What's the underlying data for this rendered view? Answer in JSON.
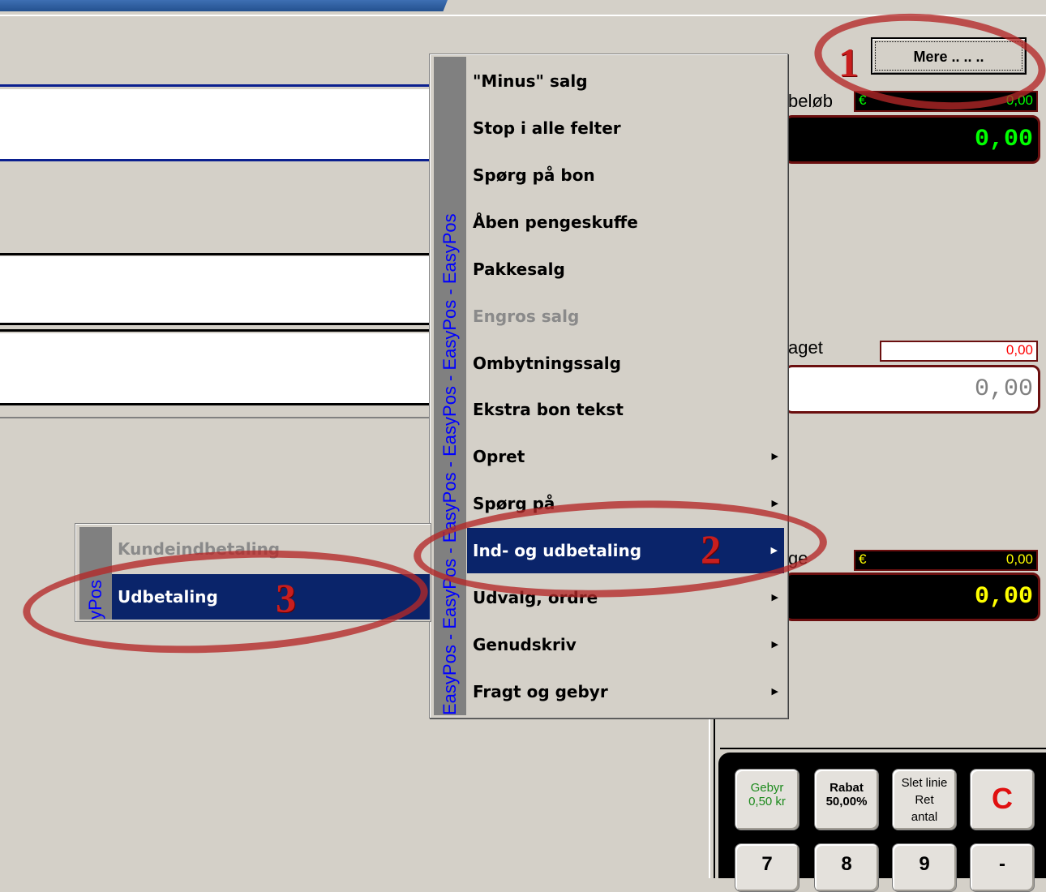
{
  "menu": {
    "strip_text": "EasyPos  -  EasyPos  -  EasyPos  -  EasyPos  -  EasyPos  -  EasyPos",
    "items": [
      {
        "label": "\"Minus\" salg",
        "enabled": true,
        "submenu": false
      },
      {
        "label": "Stop i alle felter",
        "enabled": true,
        "submenu": false
      },
      {
        "label": "Spørg på bon",
        "enabled": true,
        "submenu": false
      },
      {
        "label": "Åben pengeskuffe",
        "enabled": true,
        "submenu": false
      },
      {
        "label": "Pakkesalg",
        "enabled": true,
        "submenu": false
      },
      {
        "label": "Engros salg",
        "enabled": false,
        "submenu": false
      },
      {
        "label": "Ombytningssalg",
        "enabled": true,
        "submenu": false
      },
      {
        "label": "Ekstra bon tekst",
        "enabled": true,
        "submenu": false
      },
      {
        "label": "Opret",
        "enabled": true,
        "submenu": true
      },
      {
        "label": "Spørg på",
        "enabled": true,
        "submenu": true
      },
      {
        "label": "Ind- og udbetaling",
        "enabled": true,
        "submenu": true,
        "selected": true
      },
      {
        "label": "Udvalg, ordre",
        "enabled": true,
        "submenu": true
      },
      {
        "label": "Genudskriv",
        "enabled": true,
        "submenu": true
      },
      {
        "label": "Fragt og gebyr",
        "enabled": true,
        "submenu": true
      }
    ]
  },
  "submenu": {
    "strip_text": "yPos",
    "items": [
      {
        "label": "Kundeindbetaling",
        "enabled": false
      },
      {
        "label": "Udbetaling",
        "enabled": true,
        "selected": true
      }
    ]
  },
  "toolbar": {
    "mere_label": "Mere .. .. .."
  },
  "amounts": {
    "total_label": "beløb",
    "total_currency": "€",
    "total_small": "0,00",
    "total_big": "0,00",
    "received_label": "aget",
    "received_small": "0,00",
    "received_big": "0,00",
    "change_label": "ge",
    "change_currency": "€",
    "change_small": "0,00",
    "change_big": "0,00"
  },
  "keypad": {
    "gebyr": "Gebyr",
    "gebyr_value": "0,50 kr",
    "rabat": "Rabat",
    "rabat_value": "50,00%",
    "slet_line1": "Slet linie",
    "slet_line2": "Ret",
    "slet_line3": "antal",
    "clear": "C",
    "k7": "7",
    "k8": "8",
    "k9": "9",
    "kminus": "-"
  },
  "annotations": [
    "1",
    "2",
    "3"
  ],
  "colors": {
    "menu_selected": "#0a246a",
    "strip_text": "#0000ff",
    "annotation": "#c81e1e",
    "amount_green": "#00ff00",
    "amount_yellow": "#ffff00",
    "amount_red": "#ff0000"
  }
}
